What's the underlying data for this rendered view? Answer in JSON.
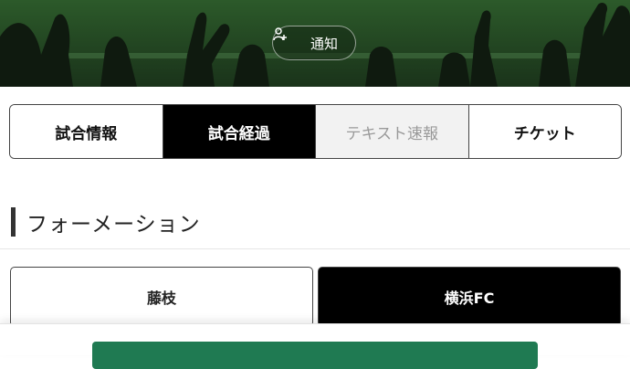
{
  "hero": {
    "notify_label": "通知",
    "notify_icon": "person-plus-icon",
    "background_color": "#1d3d1d"
  },
  "tabs": [
    {
      "label": "試合情報",
      "state": "normal"
    },
    {
      "label": "試合経過",
      "state": "active"
    },
    {
      "label": "テキスト速報",
      "state": "disabled"
    },
    {
      "label": "チケット",
      "state": "normal"
    }
  ],
  "section": {
    "title": "フォーメーション"
  },
  "teams": {
    "home": {
      "label": "藤枝",
      "selected": false
    },
    "away": {
      "label": "横浜FC",
      "selected": true
    }
  },
  "bottom_bar": {
    "accent_color": "#1f7a52"
  }
}
